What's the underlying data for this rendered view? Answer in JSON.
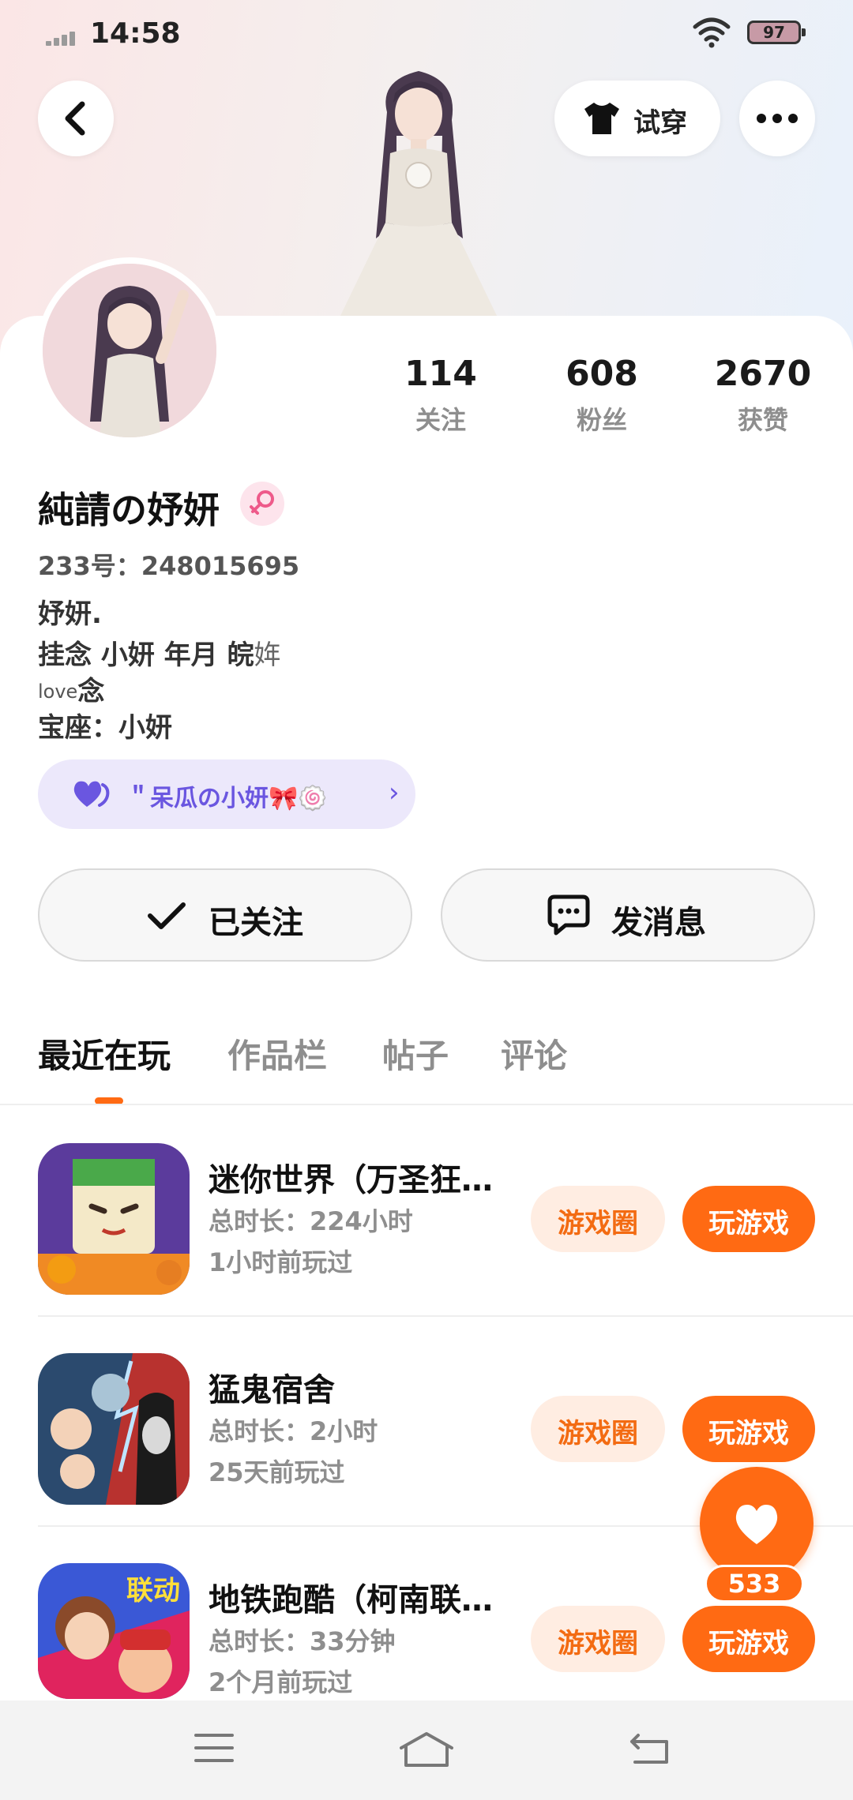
{
  "status_bar": {
    "time": "14:58",
    "battery": "97"
  },
  "header": {
    "tryon_label": "试穿"
  },
  "stats": [
    {
      "value": "114",
      "label": "关注"
    },
    {
      "value": "608",
      "label": "粉丝"
    },
    {
      "value": "2670",
      "label": "获赞"
    }
  ],
  "profile": {
    "username": "純請の妤妍",
    "user_id": "233号：248015695",
    "bio_line1": "妤妍.",
    "bio_line2": "挂念  小妍  年月  皖",
    "bio_line2_tail": "姩",
    "bio_line3_small": "love",
    "bio_line3": "念",
    "bio_line4": "宝座：小妍"
  },
  "family_pill": {
    "label": "＂呆瓜の小妍🎀🍥"
  },
  "actions": {
    "follow_label": "已关注",
    "message_label": "发消息"
  },
  "tabs": [
    {
      "label": "最近在玩",
      "active": true
    },
    {
      "label": "作品栏",
      "active": false
    },
    {
      "label": "帖子",
      "active": false
    },
    {
      "label": "评论",
      "active": false
    }
  ],
  "games": [
    {
      "name": "迷你世界（万圣狂…",
      "duration": "总时长：224小时",
      "last_played": "1小时前玩过",
      "circle_label": "游戏圈",
      "play_label": "玩游戏"
    },
    {
      "name": "猛鬼宿舍",
      "duration": "总时长：2小时",
      "last_played": "25天前玩过",
      "circle_label": "游戏圈",
      "play_label": "玩游戏"
    },
    {
      "name": "地铁跑酷（柯南联…",
      "duration": "总时长：33分钟",
      "last_played": "2个月前玩过",
      "circle_label": "游戏圈",
      "play_label": "玩游戏",
      "badge": "联动"
    }
  ],
  "like_fab": {
    "count": "533"
  },
  "colors": {
    "accent": "#ff6a13",
    "accent_soft": "#ffede2",
    "family_pill_bg": "#ece8fb",
    "family_pill_text": "#6a56e0"
  },
  "icons": [
    "back-icon",
    "tshirt-icon",
    "more-icon",
    "female-icon",
    "heart-icon",
    "check-icon",
    "chat-icon",
    "menu-icon",
    "home-icon",
    "return-icon"
  ]
}
